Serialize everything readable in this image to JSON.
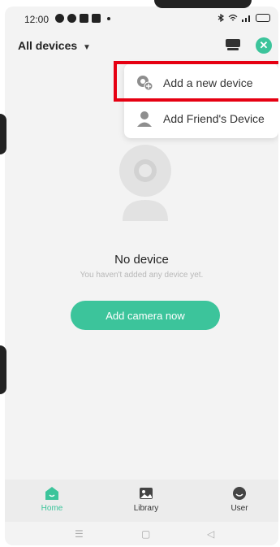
{
  "status_bar": {
    "time": "12:00"
  },
  "header": {
    "title": "All devices"
  },
  "menu": {
    "items": [
      {
        "label": "Add a new device",
        "icon": "add-device-icon"
      },
      {
        "label": "Add Friend's Device",
        "icon": "person-icon"
      }
    ]
  },
  "empty_state": {
    "title": "No device",
    "subtitle": "You haven't added any device yet.",
    "button_label": "Add camera now"
  },
  "bottom_nav": {
    "items": [
      {
        "label": "Home",
        "icon": "home-icon"
      },
      {
        "label": "Library",
        "icon": "image-icon"
      },
      {
        "label": "User",
        "icon": "user-icon"
      }
    ]
  },
  "colors": {
    "accent": "#3cc49b",
    "highlight": "#e60012"
  }
}
